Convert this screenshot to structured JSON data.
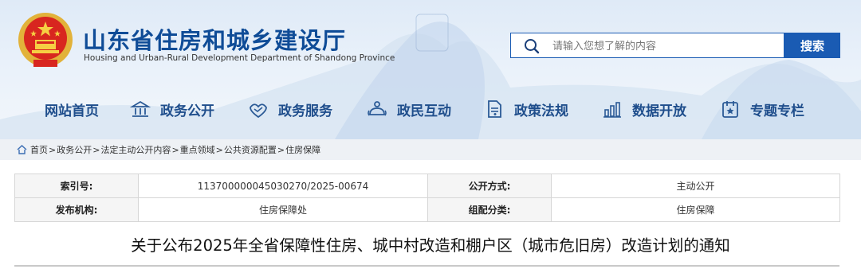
{
  "header": {
    "title": "山东省住房和城乡建设厅",
    "subtitle": "Housing and Urban-Rural Development Department of Shandong Province",
    "emblem_icon": "national-emblem-icon"
  },
  "search": {
    "placeholder": "请输入您想了解的内容",
    "button_label": "搜索",
    "icon": "search-icon"
  },
  "nav": {
    "items": [
      {
        "label": "网站首页",
        "icon": ""
      },
      {
        "label": "政务公开",
        "icon": "building-icon"
      },
      {
        "label": "政务服务",
        "icon": "handshake-icon"
      },
      {
        "label": "政民互动",
        "icon": "chat-icon"
      },
      {
        "label": "政策法规",
        "icon": "document-icon"
      },
      {
        "label": "数据开放",
        "icon": "bar-chart-icon"
      },
      {
        "label": "专题专栏",
        "icon": "folder-icon"
      }
    ]
  },
  "breadcrumb": {
    "items": [
      "首页",
      "政务公开",
      "法定主动公开内容",
      "重点领域",
      "公共资源配置",
      "住房保障"
    ],
    "separator": ">"
  },
  "meta": {
    "index_label": "索引号:",
    "index_value": "113700000045030270/2025-00674",
    "open_mode_label": "公开方式:",
    "open_mode_value": "主动公开",
    "publisher_label": "发布机构:",
    "publisher_value": "住房保障处",
    "category_label": "组配分类:",
    "category_value": "住房保障"
  },
  "document": {
    "title": "关于公布2025年全省保障性住房、城中村改造和棚户区（城市危旧房）改造计划的通知"
  },
  "colors": {
    "brand_blue": "#0f4c97",
    "button_blue": "#1a5bb3",
    "nav_text": "#1f4e8c"
  }
}
